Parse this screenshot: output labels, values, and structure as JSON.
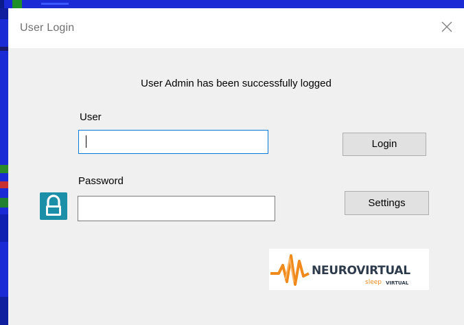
{
  "window": {
    "title": "User Login",
    "close_icon": "close-icon"
  },
  "status_message": "User Admin has been successfully logged",
  "form": {
    "user_label": "User",
    "user_value": "",
    "password_label": "Password",
    "password_value": ""
  },
  "buttons": {
    "login_label": "Login",
    "settings_label": "Settings"
  },
  "icons": {
    "lock": "lock-icon"
  },
  "logo": {
    "main_text": "NEUROVIRTUAL",
    "sub_text": "sleep",
    "sub_text2": "VIRTUAL",
    "accent_color": "#f08a1c",
    "text_color": "#2d3a4b"
  },
  "colors": {
    "dialog_bg": "#f0f0f0",
    "titlebar_bg": "#ffffff",
    "focus_border": "#0078d7",
    "lock_bg": "#1b8ea8"
  }
}
